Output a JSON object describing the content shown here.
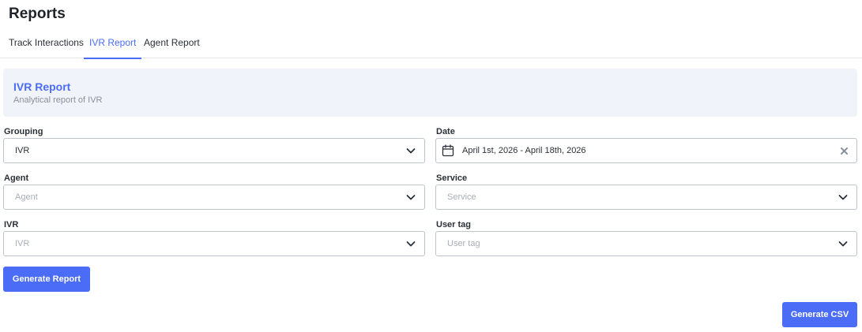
{
  "header": {
    "title": "Reports"
  },
  "tabs": [
    {
      "label": "Track Interactions"
    },
    {
      "label": "IVR Report"
    },
    {
      "label": "Agent Report"
    }
  ],
  "banner": {
    "title": "IVR Report",
    "subtitle": "Analytical report of IVR"
  },
  "form": {
    "grouping": {
      "label": "Grouping",
      "value": "IVR"
    },
    "date": {
      "label": "Date",
      "value": "April 1st, 2026 - April 18th, 2026"
    },
    "agent": {
      "label": "Agent",
      "placeholder": "Agent"
    },
    "service": {
      "label": "Service",
      "placeholder": "Service"
    },
    "ivr": {
      "label": "IVR",
      "placeholder": "IVR"
    },
    "user_tag": {
      "label": "User tag",
      "placeholder": "User tag"
    }
  },
  "actions": {
    "generate_report": "Generate Report",
    "generate_csv": "Generate CSV"
  },
  "colors": {
    "accent": "#4a6cf7",
    "banner_bg": "#f0f3f9",
    "border": "#bfc4cc"
  }
}
